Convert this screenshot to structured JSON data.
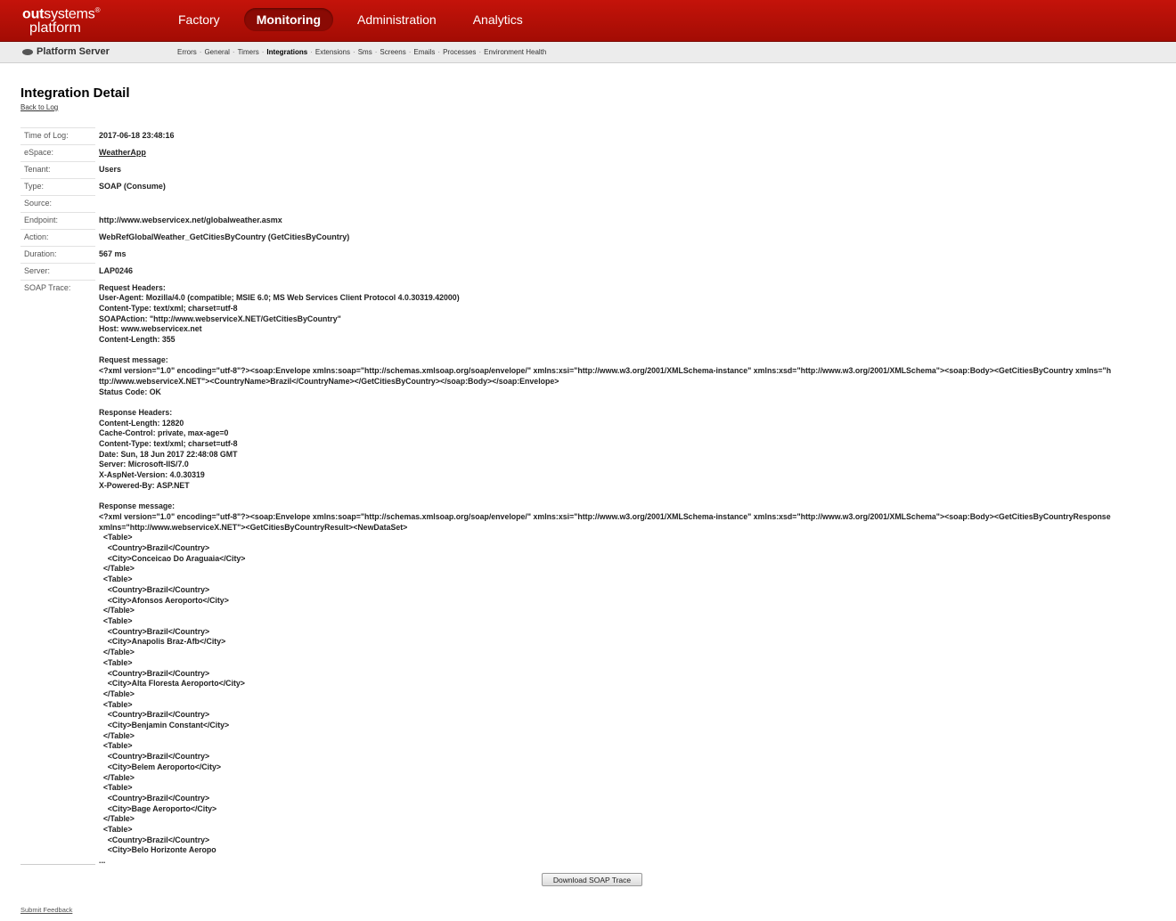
{
  "logo": {
    "line1_bold": "out",
    "line1_rest": "systems",
    "line1_mark": "®",
    "line2": "platform"
  },
  "nav": {
    "items": [
      {
        "label": "Factory"
      },
      {
        "label": "Monitoring"
      },
      {
        "label": "Administration"
      },
      {
        "label": "Analytics"
      }
    ]
  },
  "subbar": {
    "title": "Platform Server",
    "links": [
      "Errors",
      "General",
      "Timers",
      "Integrations",
      "Extensions",
      "Sms",
      "Screens",
      "Emails",
      "Processes",
      "Environment Health"
    ]
  },
  "page": {
    "title": "Integration Detail",
    "back_link": "Back to Log"
  },
  "details": {
    "time_label": "Time of Log:",
    "time_value": "2017-06-18 23:48:16",
    "espace_label": "eSpace:",
    "espace_value": "WeatherApp",
    "tenant_label": "Tenant:",
    "tenant_value": "Users",
    "type_label": "Type:",
    "type_value": "SOAP (Consume)",
    "source_label": "Source:",
    "source_value": "",
    "endpoint_label": "Endpoint:",
    "endpoint_value": "http://www.webservicex.net/globalweather.asmx",
    "action_label": "Action:",
    "action_value": "WebRefGlobalWeather_GetCitiesByCountry (GetCitiesByCountry)",
    "duration_label": "Duration:",
    "duration_value": "567 ms",
    "server_label": "Server:",
    "server_value": "LAP0246",
    "trace_label": "SOAP Trace:"
  },
  "soap_trace": "Request Headers:\nUser-Agent: Mozilla/4.0 (compatible; MSIE 6.0; MS Web Services Client Protocol 4.0.30319.42000)\nContent-Type: text/xml; charset=utf-8\nSOAPAction: \"http://www.webserviceX.NET/GetCitiesByCountry\"\nHost: www.webservicex.net\nContent-Length: 355\n\nRequest message:\n<?xml version=\"1.0\" encoding=\"utf-8\"?><soap:Envelope xmlns:soap=\"http://schemas.xmlsoap.org/soap/envelope/\" xmlns:xsi=\"http://www.w3.org/2001/XMLSchema-instance\" xmlns:xsd=\"http://www.w3.org/2001/XMLSchema\"><soap:Body><GetCitiesByCountry xmlns=\"h\nttp://www.webserviceX.NET\"><CountryName>Brazil</CountryName></GetCitiesByCountry></soap:Body></soap:Envelope>\nStatus Code: OK\n\nResponse Headers:\nContent-Length: 12820\nCache-Control: private, max-age=0\nContent-Type: text/xml; charset=utf-8\nDate: Sun, 18 Jun 2017 22:48:08 GMT\nServer: Microsoft-IIS/7.0\nX-AspNet-Version: 4.0.30319\nX-Powered-By: ASP.NET\n\nResponse message:\n<?xml version=\"1.0\" encoding=\"utf-8\"?><soap:Envelope xmlns:soap=\"http://schemas.xmlsoap.org/soap/envelope/\" xmlns:xsi=\"http://www.w3.org/2001/XMLSchema-instance\" xmlns:xsd=\"http://www.w3.org/2001/XMLSchema\"><soap:Body><GetCitiesByCountryResponse\nxmlns=\"http://www.webserviceX.NET\"><GetCitiesByCountryResult><NewDataSet>\n  <Table>\n    <Country>Brazil</Country>\n    <City>Conceicao Do Araguaia</City>\n  </Table>\n  <Table>\n    <Country>Brazil</Country>\n    <City>Afonsos Aeroporto</City>\n  </Table>\n  <Table>\n    <Country>Brazil</Country>\n    <City>Anapolis Braz-Afb</City>\n  </Table>\n  <Table>\n    <Country>Brazil</Country>\n    <City>Alta Floresta Aeroporto</City>\n  </Table>\n  <Table>\n    <Country>Brazil</Country>\n    <City>Benjamin Constant</City>\n  </Table>\n  <Table>\n    <Country>Brazil</Country>\n    <City>Belem Aeroporto</City>\n  </Table>\n  <Table>\n    <Country>Brazil</Country>\n    <City>Bage Aeroporto</City>\n  </Table>\n  <Table>\n    <Country>Brazil</Country>\n    <City>Belo Horizonte Aeropo\n...",
  "download_button": "Download SOAP Trace",
  "feedback_link": "Submit Feedback",
  "colors": {
    "topbar": "#b8100a",
    "active_nav": "#8a0a04",
    "subbar": "#ececec"
  }
}
